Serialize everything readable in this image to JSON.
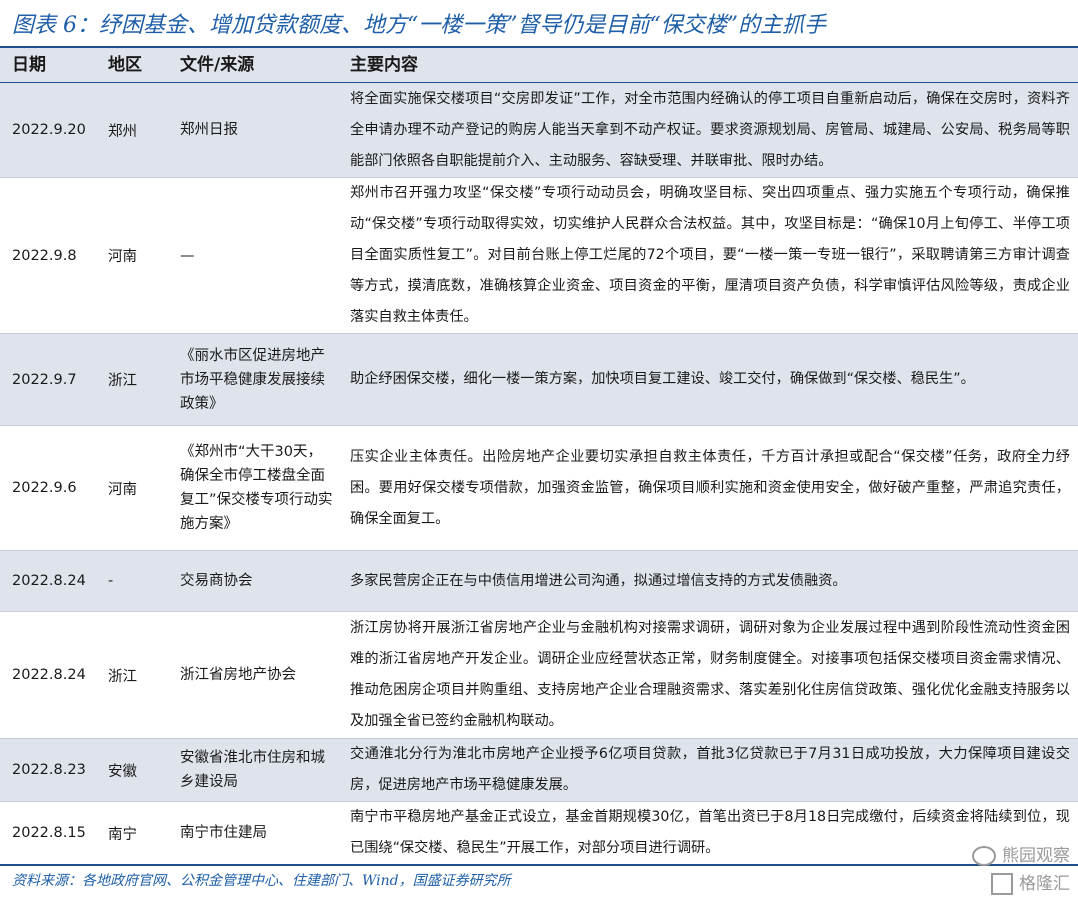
{
  "title": "图表 6：纾困基金、增加贷款额度、地方“一楼一策”督导仍是目前“保交楼”的主抓手",
  "headers": {
    "date": "日期",
    "region": "地区",
    "source": "文件/来源",
    "content": "主要内容"
  },
  "rows": [
    {
      "date": "2022.9.20",
      "region": "郑州",
      "source": "郑州日报",
      "content": "将全面实施保交楼项目“交房即发证”工作，对全市范围内经确认的停工项目自重新启动后，确保在交房时，资料齐全申请办理不动产登记的购房人能当天拿到不动产权证。要求资源规划局、房管局、城建局、公安局、税务局等职能部门依照各自职能提前介入、主动服务、容缺受理、并联审批、限时办结。"
    },
    {
      "date": "2022.9.8",
      "region": "河南",
      "source": "—",
      "content": "郑州市召开强力攻坚“保交楼”专项行动动员会，明确攻坚目标、突出四项重点、强力实施五个专项行动，确保推动“保交楼”专项行动取得实效，切实维护人民群众合法权益。其中，攻坚目标是：“确保10月上旬停工、半停工项目全面实质性复工”。对目前台账上停工烂尾的72个项目，要“一楼一策一专班一银行”，采取聘请第三方审计调查等方式，摸清底数，准确核算企业资金、项目资金的平衡，厘清项目资产负债，科学审慎评估风险等级，责成企业落实自救主体责任。"
    },
    {
      "date": "2022.9.7",
      "region": "浙江",
      "source": "《丽水市区促进房地产市场平稳健康发展接续政策》",
      "content": "助企纾困保交楼，细化一楼一策方案，加快项目复工建设、竣工交付，确保做到“保交楼、稳民生”。"
    },
    {
      "date": "2022.9.6",
      "region": "河南",
      "source": "《郑州市“大干30天，确保全市停工楼盘全面复工”保交楼专项行动实施方案》",
      "content": "压实企业主体责任。出险房地产企业要切实承担自救主体责任，千方百计承担或配合“保交楼”任务，政府全力纾困。要用好保交楼专项借款，加强资金监管，确保项目顺利实施和资金使用安全，做好破产重整，严肃追究责任，确保全面复工。"
    },
    {
      "date": "2022.8.24",
      "region": "-",
      "source": "交易商协会",
      "content": "多家民营房企正在与中债信用增进公司沟通，拟通过增信支持的方式发债融资。"
    },
    {
      "date": "2022.8.24",
      "region": "浙江",
      "source": "浙江省房地产协会",
      "content": "浙江房协将开展浙江省房地产企业与金融机构对接需求调研，调研对象为企业发展过程中遇到阶段性流动性资金困难的浙江省房地产开发企业。调研企业应经营状态正常，财务制度健全。对接事项包括保交楼项目资金需求情况、推动危困房企项目并购重组、支持房地产企业合理融资需求、落实差别化住房信贷政策、强化优化金融支持服务以及加强全省已签约金融机构联动。"
    },
    {
      "date": "2022.8.23",
      "region": "安徽",
      "source": "安徽省淮北市住房和城乡建设局",
      "content": "交通淮北分行为淮北市房地产企业授予6亿项目贷款，首批3亿贷款已于7月31日成功投放，大力保障项目建设交房，促进房地产市场平稳健康发展。"
    },
    {
      "date": "2022.8.15",
      "region": "南宁",
      "source": "南宁市住建局",
      "content": "南宁市平稳房地产基金正式设立，基金首期规模30亿，首笔出资已于8月18日完成缴付，后续资金将陆续到位，现已围绕“保交楼、稳民生”开展工作，对部分项目进行调研。"
    }
  ],
  "footer": "资料来源：各地政府官网、公积金管理中心、住建部门、Wind，国盛证券研究所",
  "watermark": {
    "line1": "熊园观察",
    "line2": "格隆汇"
  }
}
